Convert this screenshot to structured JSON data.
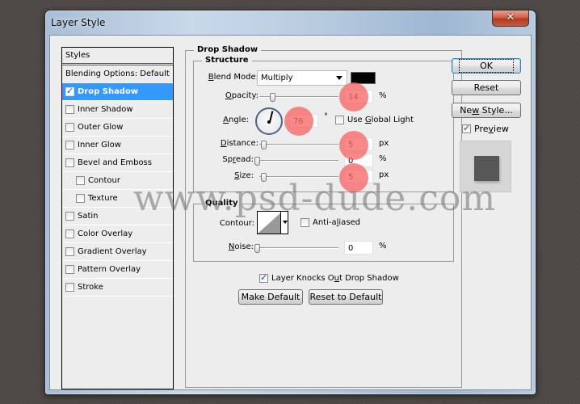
{
  "window": {
    "title": "Layer Style",
    "close_glyph": "✕"
  },
  "styles_panel": {
    "header": "Styles",
    "items": [
      {
        "label": "Blending Options: Default",
        "checkbox": false,
        "checked": false,
        "selected": false,
        "sub": false
      },
      {
        "label": "Drop Shadow",
        "checkbox": true,
        "checked": true,
        "selected": true,
        "sub": false
      },
      {
        "label": "Inner Shadow",
        "checkbox": true,
        "checked": false,
        "selected": false,
        "sub": false
      },
      {
        "label": "Outer Glow",
        "checkbox": true,
        "checked": false,
        "selected": false,
        "sub": false
      },
      {
        "label": "Inner Glow",
        "checkbox": true,
        "checked": false,
        "selected": false,
        "sub": false
      },
      {
        "label": "Bevel and Emboss",
        "checkbox": true,
        "checked": false,
        "selected": false,
        "sub": false
      },
      {
        "label": "Contour",
        "checkbox": true,
        "checked": false,
        "selected": false,
        "sub": true
      },
      {
        "label": "Texture",
        "checkbox": true,
        "checked": false,
        "selected": false,
        "sub": true
      },
      {
        "label": "Satin",
        "checkbox": true,
        "checked": false,
        "selected": false,
        "sub": false
      },
      {
        "label": "Color Overlay",
        "checkbox": true,
        "checked": false,
        "selected": false,
        "sub": false
      },
      {
        "label": "Gradient Overlay",
        "checkbox": true,
        "checked": false,
        "selected": false,
        "sub": false
      },
      {
        "label": "Pattern Overlay",
        "checkbox": true,
        "checked": false,
        "selected": false,
        "sub": false
      },
      {
        "label": "Stroke",
        "checkbox": true,
        "checked": false,
        "selected": false,
        "sub": false
      }
    ]
  },
  "drop_shadow": {
    "section_title": "Drop Shadow",
    "structure": {
      "title": "Structure",
      "blend_mode": {
        "label_u": "B",
        "label_rest": "lend Mode:",
        "value": "Multiply",
        "color": "#000000"
      },
      "opacity": {
        "label_u": "O",
        "label_rest": "pacity:",
        "value": "14",
        "unit": "%",
        "fraction": 0.14
      },
      "angle": {
        "label_u": "A",
        "label_rest": "ngle:",
        "value": "76",
        "unit": "°",
        "degrees": 76
      },
      "use_global_light": {
        "pre": "Use ",
        "u": "G",
        "post": "lobal Light",
        "checked": false
      },
      "distance": {
        "label_u": "D",
        "label_rest": "istance:",
        "value": "5",
        "unit": "px",
        "fraction": 0.02
      },
      "spread": {
        "label_pre": "Sp",
        "label_u": "r",
        "label_post": "ead:",
        "value": "0",
        "unit": "%",
        "fraction": 0
      },
      "size": {
        "label_u": "S",
        "label_rest": "ize:",
        "value": "5",
        "unit": "px",
        "fraction": 0.02
      }
    },
    "quality": {
      "title": "Quality",
      "contour_label": "Contour:",
      "anti_aliased": {
        "pre": "Anti-a",
        "u": "l",
        "post": "iased",
        "checked": false
      },
      "noise": {
        "label_u": "N",
        "label_rest": "oise:",
        "value": "0",
        "unit": "%",
        "fraction": 0
      }
    },
    "knocks_out": {
      "pre": "Layer Knocks O",
      "u": "u",
      "post": "t Drop Shadow",
      "checked": true
    },
    "make_default": "Make Default",
    "reset_to_default": "Reset to Default"
  },
  "buttons": {
    "ok": "OK",
    "reset": "Reset",
    "new_style_pre": "Ne",
    "new_style_u": "w",
    "new_style_post": " Style..."
  },
  "preview": {
    "pre": "Pre",
    "u": "v",
    "post": "iew",
    "checked": true
  },
  "watermark": "www.psd-dude.com"
}
